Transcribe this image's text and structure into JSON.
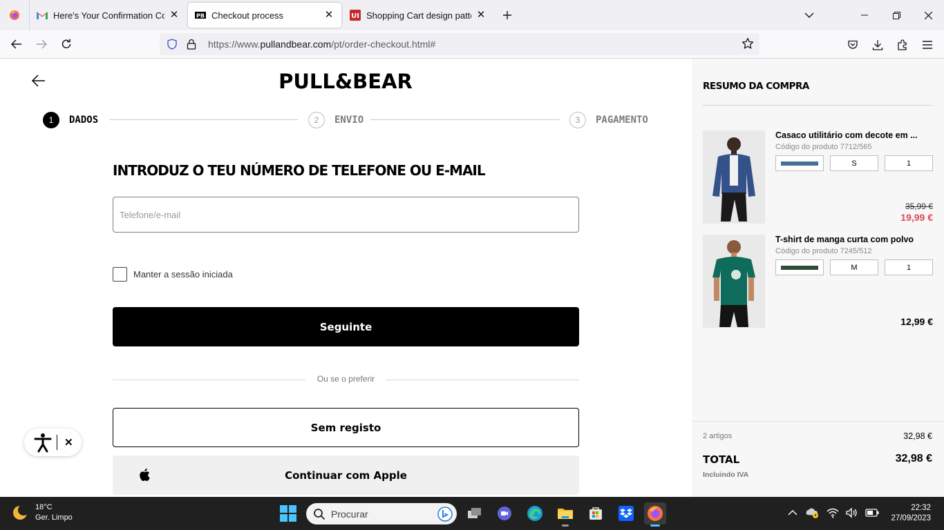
{
  "browser": {
    "tabs": [
      {
        "title": "Here's Your Confirmation Code",
        "favicon": "gmail-icon"
      },
      {
        "title": "Checkout process",
        "favicon": "pullandbear-favicon"
      },
      {
        "title": "Shopping Cart design pattern",
        "favicon": "ui-patterns-favicon"
      }
    ],
    "url_prefix": "https://www.",
    "url_host": "pullandbear.com",
    "url_path": "/pt/order-checkout.html#"
  },
  "page": {
    "logo": "PULL&BEAR",
    "steps": [
      {
        "num": "1",
        "label": "DADOS"
      },
      {
        "num": "2",
        "label": "ENVIO"
      },
      {
        "num": "3",
        "label": "PAGAMENTO"
      }
    ],
    "heading": "INTRODUZ O TEU NÚMERO DE TELEFONE OU E-MAIL",
    "input_placeholder": "Telefone/e-mail",
    "input_value": "",
    "remember_label": "Manter a sessão iniciada",
    "next_button": "Seguinte",
    "divider_text": "Ou se o preferir",
    "guest_button": "Sem registo",
    "apple_button": "Continuar com Apple"
  },
  "summary": {
    "title": "RESUMO DA COMPRA",
    "products": [
      {
        "name": "Casaco utilitário com decote em ...",
        "code": "Código do produto 7712/565",
        "color": "#4a6f96",
        "size": "S",
        "qty": "1",
        "old_price": "35,99 €",
        "price": "19,99 €"
      },
      {
        "name": "T-shirt de manga curta com polvo",
        "code": "Código do produto 7245/512",
        "color": "#2e4c3a",
        "size": "M",
        "qty": "1",
        "price": "12,99 €"
      }
    ],
    "items_count": "2 artigos",
    "items_value": "32,98 €",
    "total_label": "TOTAL",
    "total_value": "32,98 €",
    "tax_note": "Incluindo IVA"
  },
  "taskbar": {
    "weather_temp": "18°C",
    "weather_desc": "Ger. Limpo",
    "search_placeholder": "Procurar",
    "time": "22:32",
    "date": "27/09/2023"
  },
  "colors": {
    "sale_price": "#e0475b",
    "primary_button": "#000000"
  }
}
